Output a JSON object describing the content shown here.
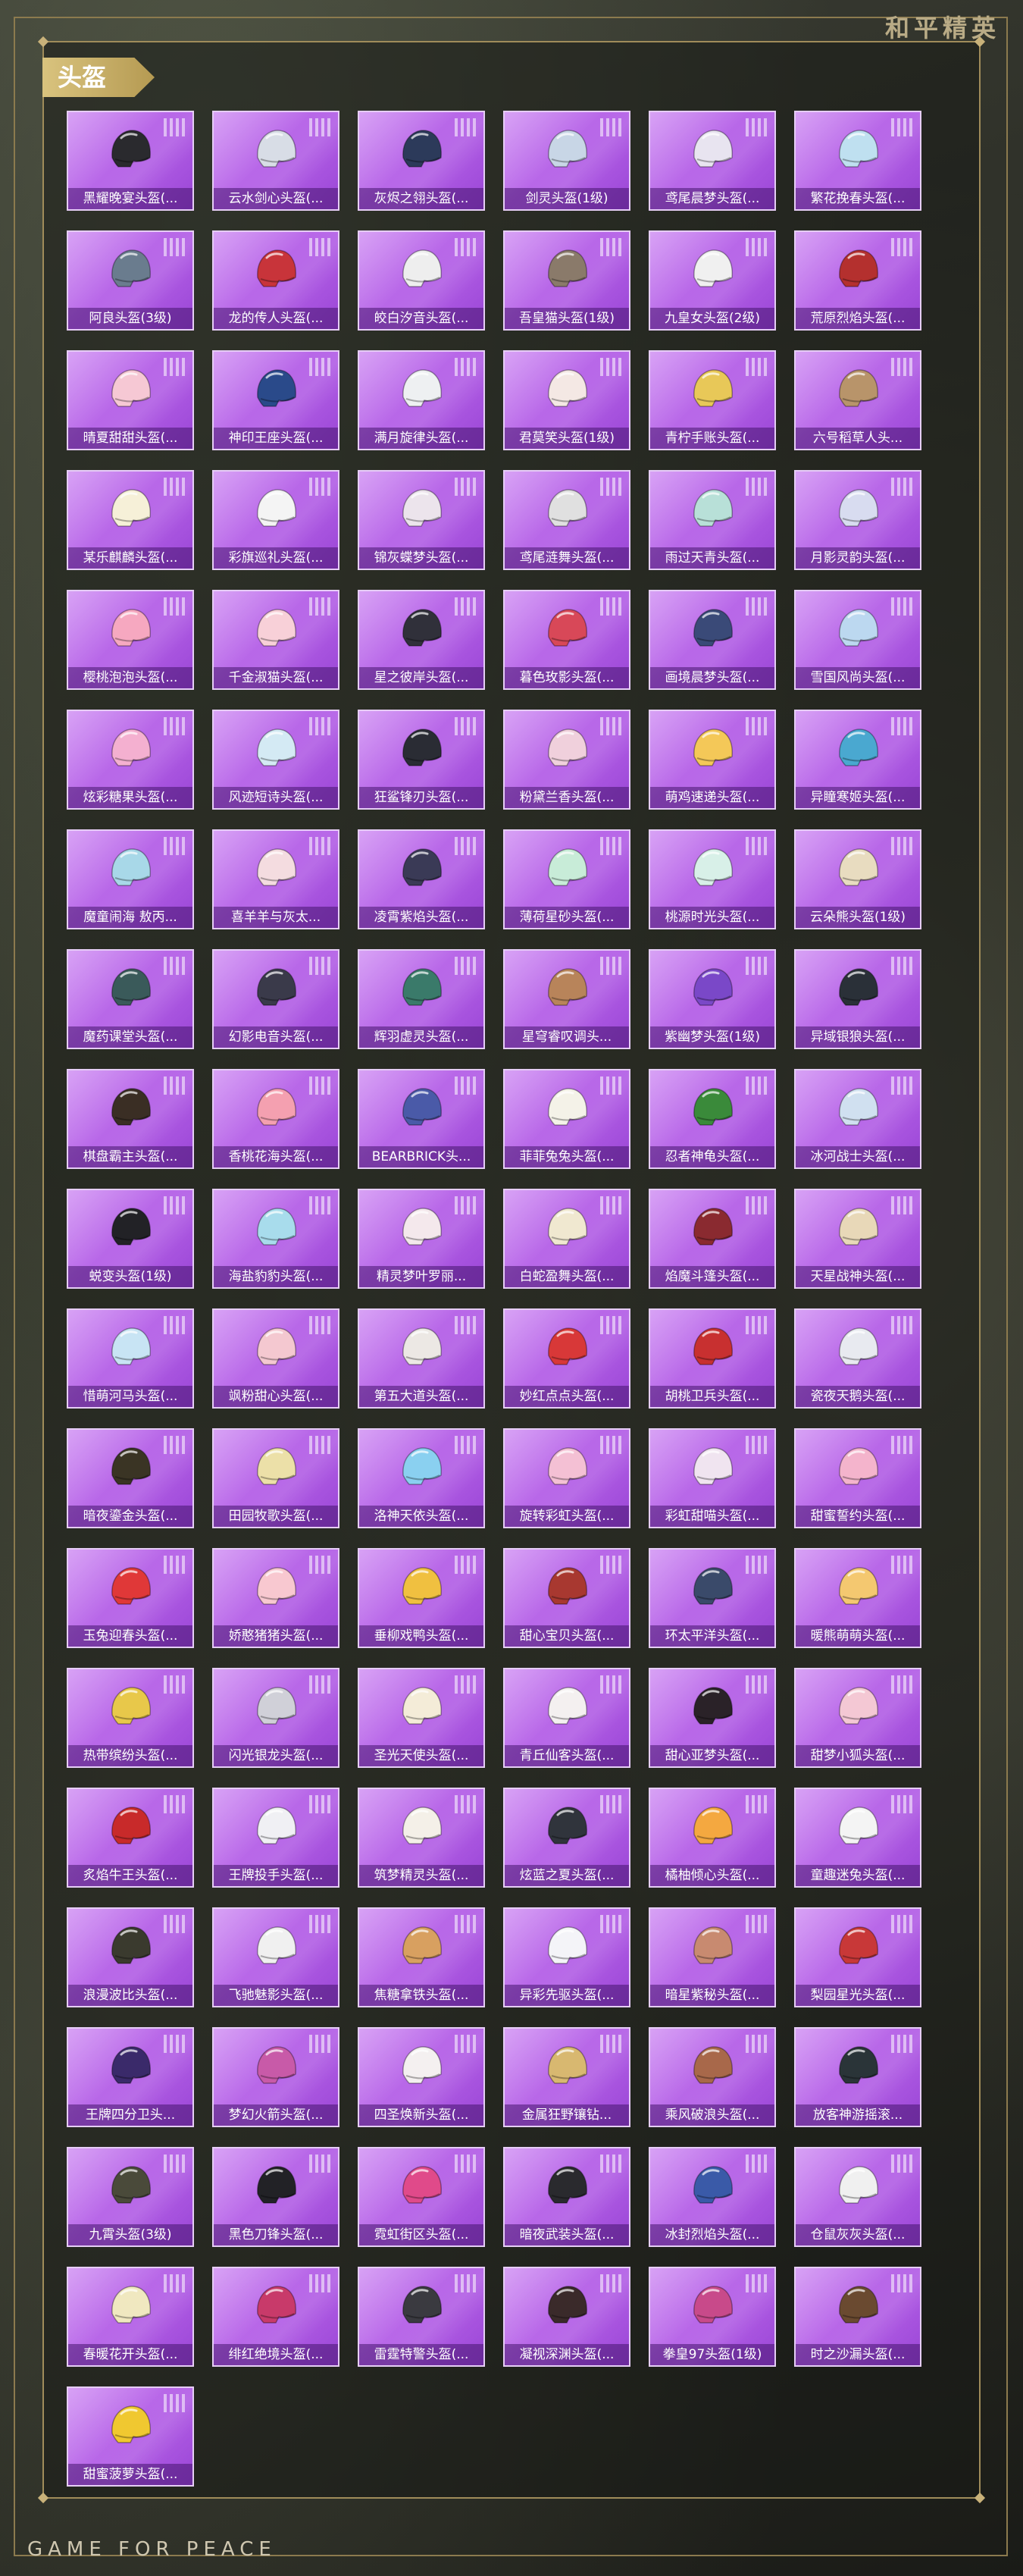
{
  "brand": "和平精英",
  "section_title": "头盔",
  "footer": "GAME FOR PEACE",
  "items": [
    {
      "name": "黑耀晚宴头盔(...",
      "color": "#2a2a2e"
    },
    {
      "name": "云水剑心头盔(...",
      "color": "#d8dde6"
    },
    {
      "name": "灰烬之翎头盔(...",
      "color": "#2c3a5a"
    },
    {
      "name": "剑灵头盔(1级)",
      "color": "#c8d6e6"
    },
    {
      "name": "鸢尾晨梦头盔(...",
      "color": "#e8e4f0"
    },
    {
      "name": "繁花挽春头盔(...",
      "color": "#bfe0f0"
    },
    {
      "name": "阿良头盔(3级)",
      "color": "#6a7c8e"
    },
    {
      "name": "龙的传人头盔(...",
      "color": "#c8343a"
    },
    {
      "name": "皎白汐音头盔(...",
      "color": "#eeeeee"
    },
    {
      "name": "吾皇猫头盔(1级)",
      "color": "#8a7a6a"
    },
    {
      "name": "九皇女头盔(2级)",
      "color": "#f0f0f0"
    },
    {
      "name": "荒原烈焰头盔(...",
      "color": "#b4302e"
    },
    {
      "name": "晴夏甜甜头盔(...",
      "color": "#f6c8d4"
    },
    {
      "name": "神印王座头盔(...",
      "color": "#2a4a8a"
    },
    {
      "name": "满月旋律头盔(...",
      "color": "#eef0f2"
    },
    {
      "name": "君莫笑头盔(1级)",
      "color": "#f4e8e4"
    },
    {
      "name": "青柠手账头盔(...",
      "color": "#e8c858"
    },
    {
      "name": "六号稻草人头...",
      "color": "#b8946a"
    },
    {
      "name": "某乐麒麟头盔(...",
      "color": "#f6f0d8"
    },
    {
      "name": "彩旗巡礼头盔(...",
      "color": "#f4f4f4"
    },
    {
      "name": "锦灰蝶梦头盔(...",
      "color": "#ece4ec"
    },
    {
      "name": "鸢尾涟舞头盔(...",
      "color": "#e0e0e0"
    },
    {
      "name": "雨过天青头盔(...",
      "color": "#b8e0d8"
    },
    {
      "name": "月影灵韵头盔(...",
      "color": "#d8dcf0"
    },
    {
      "name": "樱桃泡泡头盔(...",
      "color": "#f6a8c0"
    },
    {
      "name": "千金淑猫头盔(...",
      "color": "#f8d0d8"
    },
    {
      "name": "星之彼岸头盔(...",
      "color": "#30303a"
    },
    {
      "name": "暮色玫影头盔(...",
      "color": "#d84858"
    },
    {
      "name": "画境晨梦头盔(...",
      "color": "#3a4a78"
    },
    {
      "name": "雪国风尚头盔(...",
      "color": "#bcd8f0"
    },
    {
      "name": "炫彩糖果头盔(...",
      "color": "#f4b0d0"
    },
    {
      "name": "风迹短诗头盔(...",
      "color": "#d4eaf4"
    },
    {
      "name": "狂鲨锋刃头盔(...",
      "color": "#2a2c34"
    },
    {
      "name": "粉黛兰香头盔(...",
      "color": "#f0d0dc"
    },
    {
      "name": "萌鸡速递头盔(...",
      "color": "#f4c858"
    },
    {
      "name": "异瞳寒姬头盔(...",
      "color": "#4aa8d0"
    },
    {
      "name": "魔童闹海 敖丙...",
      "color": "#a8d8e8"
    },
    {
      "name": "喜羊羊与灰太...",
      "color": "#f4dce0"
    },
    {
      "name": "凌霄紫焰头盔(...",
      "color": "#3a3a56"
    },
    {
      "name": "薄荷星砂头盔(...",
      "color": "#c8ecd8"
    },
    {
      "name": "桃源时光头盔(...",
      "color": "#d8f0e8"
    },
    {
      "name": "云朵熊头盔(1级)",
      "color": "#e8dcc0"
    },
    {
      "name": "魔药课堂头盔(...",
      "color": "#3a5a5a"
    },
    {
      "name": "幻影电音头盔(...",
      "color": "#3a3a4a"
    },
    {
      "name": "辉羽虚灵头盔(...",
      "color": "#3a7a6a"
    },
    {
      "name": "星穹睿叹调头...",
      "color": "#b8845a"
    },
    {
      "name": "紫幽梦头盔(1级)",
      "color": "#7a48c8"
    },
    {
      "name": "异域银狼头盔(...",
      "color": "#2a3038"
    },
    {
      "name": "棋盘霸主头盔(...",
      "color": "#3a2e24"
    },
    {
      "name": "香桃花海头盔(...",
      "color": "#f4a0b0"
    },
    {
      "name": "BEARBRICK头...",
      "color": "#4a5aa8"
    },
    {
      "name": "菲菲兔兔头盔(...",
      "color": "#f4f2e8"
    },
    {
      "name": "忍者神龟头盔(...",
      "color": "#3a8a3a"
    },
    {
      "name": "冰河战士头盔(...",
      "color": "#d0e0f0"
    },
    {
      "name": "蜕变头盔(1级)",
      "color": "#222226"
    },
    {
      "name": "海盐豹豹头盔(...",
      "color": "#a8dcec"
    },
    {
      "name": "精灵梦叶罗丽...",
      "color": "#f4e8ec"
    },
    {
      "name": "白蛇盈舞头盔(...",
      "color": "#f0e8d0"
    },
    {
      "name": "焰魔斗篷头盔(...",
      "color": "#8a2a30"
    },
    {
      "name": "天星战神头盔(...",
      "color": "#e8d8b8"
    },
    {
      "name": "惜萌河马头盔(...",
      "color": "#c8e4f4"
    },
    {
      "name": "飒粉甜心头盔(...",
      "color": "#f4c8d0"
    },
    {
      "name": "第五大道头盔(...",
      "color": "#ece8e4"
    },
    {
      "name": "妙红点点头盔(...",
      "color": "#d83838"
    },
    {
      "name": "胡桃卫兵头盔(...",
      "color": "#c83030"
    },
    {
      "name": "瓷夜天鹅头盔(...",
      "color": "#e8eaf0"
    },
    {
      "name": "暗夜鎏金头盔(...",
      "color": "#3a3424"
    },
    {
      "name": "田园牧歌头盔(...",
      "color": "#ece0a8"
    },
    {
      "name": "洛神天依头盔(...",
      "color": "#8ad0f0"
    },
    {
      "name": "旋转彩虹头盔(...",
      "color": "#f4c0d4"
    },
    {
      "name": "彩虹甜喵头盔(...",
      "color": "#f0e4f0"
    },
    {
      "name": "甜蜜誓约头盔(...",
      "color": "#f4b4cc"
    },
    {
      "name": "玉兔迎春头盔(...",
      "color": "#e03838"
    },
    {
      "name": "娇憨猪猪头盔(...",
      "color": "#f8c8d0"
    },
    {
      "name": "垂柳戏鸭头盔(...",
      "color": "#f0c040"
    },
    {
      "name": "甜心宝贝头盔(...",
      "color": "#a83830"
    },
    {
      "name": "环太平洋头盔(...",
      "color": "#3a4a6a"
    },
    {
      "name": "暖熊萌萌头盔(...",
      "color": "#f4c870"
    },
    {
      "name": "热带缤纷头盔(...",
      "color": "#e8c84a"
    },
    {
      "name": "闪光银龙头盔(...",
      "color": "#d0d0d8"
    },
    {
      "name": "圣光天使头盔(...",
      "color": "#f4ecd8"
    },
    {
      "name": "青丘仙客头盔(...",
      "color": "#f4f0f0"
    },
    {
      "name": "甜心亚梦头盔(...",
      "color": "#2a2228"
    },
    {
      "name": "甜梦小狐头盔(...",
      "color": "#f4c8d4"
    },
    {
      "name": "炙焰牛王头盔(...",
      "color": "#c82a2a"
    },
    {
      "name": "王牌投手头盔(...",
      "color": "#f0f0f4"
    },
    {
      "name": "筑梦精灵头盔(...",
      "color": "#f4f0e8"
    },
    {
      "name": "炫蓝之夏头盔(...",
      "color": "#30343c"
    },
    {
      "name": "橘柚倾心头盔(...",
      "color": "#f4a840"
    },
    {
      "name": "童趣迷兔头盔(...",
      "color": "#f4f4f4"
    },
    {
      "name": "浪漫波比头盔(...",
      "color": "#3a3a2e"
    },
    {
      "name": "飞驰魅影头盔(...",
      "color": "#f0f0f0"
    },
    {
      "name": "焦糖拿铁头盔(...",
      "color": "#d8a060"
    },
    {
      "name": "异彩先驱头盔(...",
      "color": "#f4f4f8"
    },
    {
      "name": "暗星紫秘头盔(...",
      "color": "#c88a70"
    },
    {
      "name": "梨园星光头盔(...",
      "color": "#c83838"
    },
    {
      "name": "王牌四分卫头...",
      "color": "#3a2a6a"
    },
    {
      "name": "梦幻火箭头盔(...",
      "color": "#c85aa8"
    },
    {
      "name": "四圣焕新头盔(...",
      "color": "#f4f0f0"
    },
    {
      "name": "金属狂野镶钻...",
      "color": "#d8b870"
    },
    {
      "name": "乘风破浪头盔(...",
      "color": "#a8684a"
    },
    {
      "name": "放客神游摇滚...",
      "color": "#2a3438"
    },
    {
      "name": "九霄头盔(3级)",
      "color": "#4a4a3a"
    },
    {
      "name": "黑色刀锋头盔(...",
      "color": "#222226"
    },
    {
      "name": "霓虹街区头盔(...",
      "color": "#e04a8a"
    },
    {
      "name": "暗夜武装头盔(...",
      "color": "#2a2a2e"
    },
    {
      "name": "冰封烈焰头盔(...",
      "color": "#3a5aa8"
    },
    {
      "name": "仓鼠灰灰头盔(...",
      "color": "#f0f0f0"
    },
    {
      "name": "春暖花开头盔(...",
      "color": "#f0e8c0"
    },
    {
      "name": "绯红绝境头盔(...",
      "color": "#c83a6a"
    },
    {
      "name": "雷霆特警头盔(...",
      "color": "#3a3a40"
    },
    {
      "name": "凝视深渊头盔(...",
      "color": "#3a2a2a"
    },
    {
      "name": "拳皇97头盔(1级)",
      "color": "#c84a8a"
    },
    {
      "name": "时之沙漏头盔(...",
      "color": "#6a4a30"
    },
    {
      "name": "甜蜜菠萝头盔(...",
      "color": "#f0c830"
    }
  ]
}
